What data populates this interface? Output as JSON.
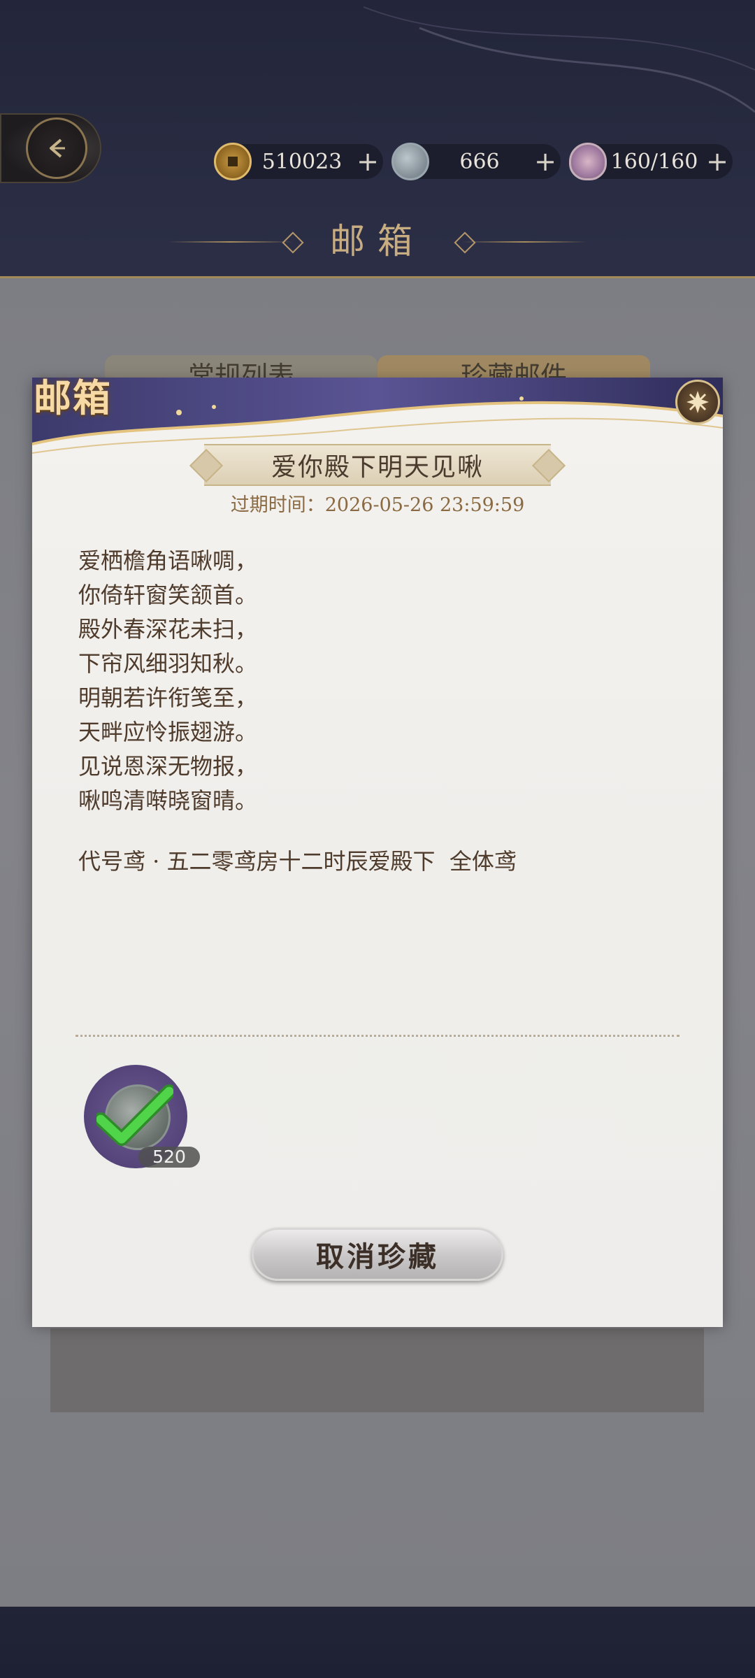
{
  "header": {
    "title": "邮箱",
    "currencies": [
      {
        "icon": "copper-coin-icon",
        "value": "510023"
      },
      {
        "icon": "jade-coin-icon",
        "value": "666"
      },
      {
        "icon": "stamina-bowl-icon",
        "value": "160/160"
      }
    ]
  },
  "background_panel": {
    "tabs": [
      "常规列表",
      "珍藏邮件"
    ]
  },
  "modal": {
    "label": "邮箱",
    "mail_title": "爱你殿下明天见啾",
    "expire_text": "过期时间：2026-05-26 23:59:59",
    "body_lines": [
      "爱栖檐角语啾啁，",
      "你倚轩窗笑颔首。",
      "殿外春深花未扫，",
      "下帘风细羽知秋。",
      "明朝若许衔笺至，",
      "天畔应怜振翅游。",
      "见说恩深无物报，",
      "啾鸣清啭晓窗晴。"
    ],
    "signature": "代号鸢 · 五二零鸢房十二时辰爱殿下  全体鸢",
    "reward": {
      "icon": "jade-coin-icon",
      "count": "520",
      "claimed": true
    },
    "action_button": "取消珍藏"
  },
  "colors": {
    "accent_gold": "#c9ad82",
    "text_brown": "#4e3b2b",
    "claimed_check": "#3ec23a"
  }
}
